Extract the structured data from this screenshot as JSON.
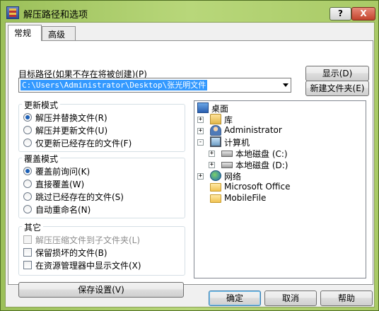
{
  "window": {
    "title": "解压路径和选项",
    "help_label": "?",
    "close_label": "X",
    "icon": "winrar-icon"
  },
  "tabs": [
    {
      "label": "常规",
      "active": true
    },
    {
      "label": "高级",
      "active": false
    }
  ],
  "target_path": {
    "label": "目标路径(如果不存在将被创建)(P)",
    "value": "C:\\Users\\Administrator\\Desktop\\张光明文件"
  },
  "buttons": {
    "show": "显示(D)",
    "new_folder": "新建文件夹(E)",
    "save_settings": "保存设置(V)",
    "ok": "确定",
    "cancel": "取消",
    "help": "帮助"
  },
  "update_mode": {
    "title": "更新模式",
    "options": [
      {
        "label": "解压并替换文件(R)",
        "selected": true
      },
      {
        "label": "解压并更新文件(U)",
        "selected": false
      },
      {
        "label": "仅更新已经存在的文件(F)",
        "selected": false
      }
    ]
  },
  "overwrite_mode": {
    "title": "覆盖模式",
    "options": [
      {
        "label": "覆盖前询问(K)",
        "selected": true
      },
      {
        "label": "直接覆盖(W)",
        "selected": false
      },
      {
        "label": "跳过已经存在的文件(S)",
        "selected": false
      },
      {
        "label": "自动重命名(N)",
        "selected": false
      }
    ]
  },
  "misc": {
    "title": "其它",
    "options": [
      {
        "label": "解压压缩文件到子文件夹(L)",
        "checked": false,
        "disabled": true
      },
      {
        "label": "保留损坏的文件(B)",
        "checked": false,
        "disabled": false
      },
      {
        "label": "在资源管理器中显示文件(X)",
        "checked": false,
        "disabled": false
      }
    ]
  },
  "tree": {
    "nodes": [
      {
        "label": "桌面",
        "icon": "desktop-icon",
        "expander": ""
      },
      {
        "label": "库",
        "icon": "library-icon",
        "expander": "+"
      },
      {
        "label": "Administrator",
        "icon": "user-folder-icon",
        "expander": "+"
      },
      {
        "label": "计算机",
        "icon": "computer-icon",
        "expander": "-"
      },
      {
        "label": "本地磁盘 (C:)",
        "icon": "drive-icon",
        "expander": "+"
      },
      {
        "label": "本地磁盘 (D:)",
        "icon": "drive-icon",
        "expander": "+"
      },
      {
        "label": "网络",
        "icon": "network-icon",
        "expander": "+"
      },
      {
        "label": "Microsoft Office",
        "icon": "folder-icon",
        "expander": ""
      },
      {
        "label": "MobileFile",
        "icon": "folder-icon",
        "expander": ""
      }
    ]
  }
}
